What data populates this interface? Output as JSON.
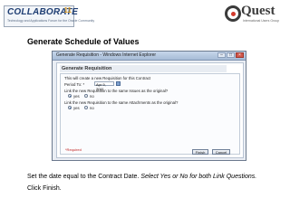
{
  "header": {
    "left_logo": {
      "word": "COLLABORATE",
      "year": "11",
      "tagline": "Technology and Applications Forum for the Oracle Community"
    },
    "right_logo": {
      "word": "Quest",
      "tagline": "International Users Group"
    }
  },
  "slide_title": "Generate Schedule of Values",
  "dialog": {
    "window_title": "Generate Requisition - Windows Internet Explorer",
    "heading": "Generate Requisition",
    "intro": "This will create a new Requisition for this Contract",
    "date_label": "Period To: *",
    "date_value": "Apr 9, 2011",
    "question1": "Link the new Requisition to the same Issues as the original?",
    "question2": "Link the new Requisition to the same Attachments as the original?",
    "yes_label": "yes",
    "no_label": "no",
    "required_note": "*Required",
    "finish_label": "Finish",
    "cancel_label": "Cancel",
    "selected": {
      "q1": "yes",
      "q2": "yes"
    }
  },
  "instructions": {
    "line1_plain": "Set the date equal to the Contract Date. ",
    "line1_italic": "Select Yes or No for both Link Questions.",
    "line2": "Click Finish."
  },
  "colors": {
    "brand": "#1f3e73",
    "accent": "#d89c2a",
    "required": "#c02020"
  }
}
